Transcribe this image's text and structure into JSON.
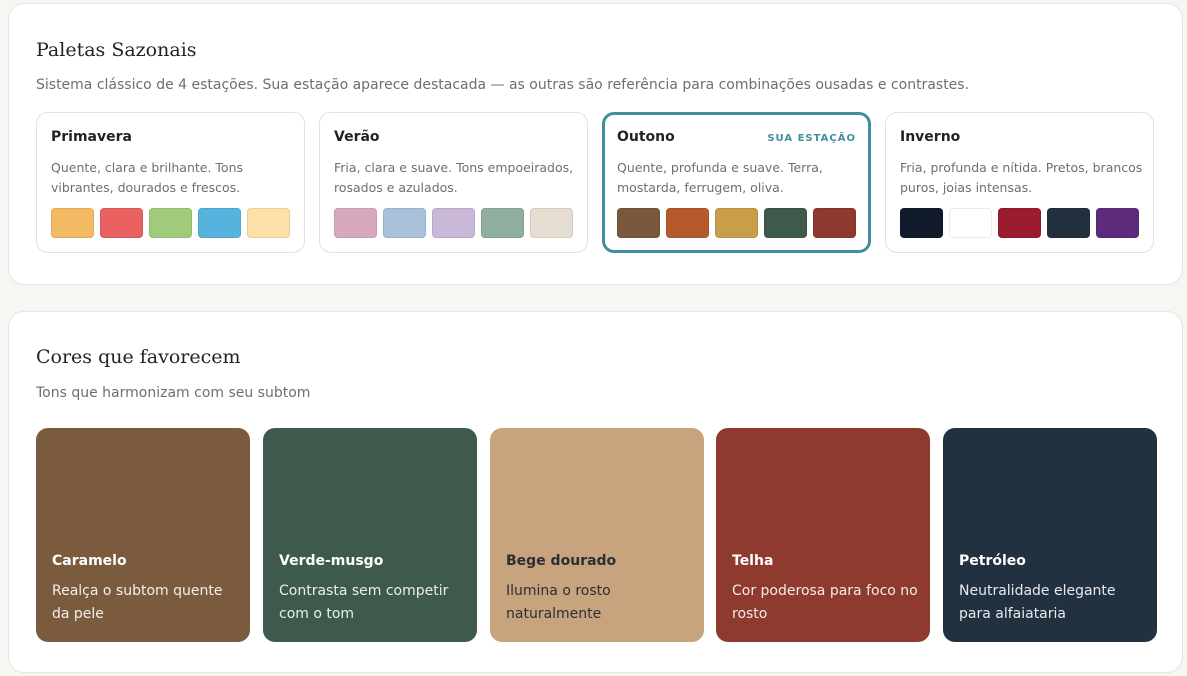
{
  "seasonal": {
    "title": "Paletas Sazonais",
    "subtitle": "Sistema clássico de 4 estações. Sua estação aparece destacada — as outras são referência para combinações ousadas e contrastes.",
    "current_badge": "SUA ESTAÇÃO",
    "accent_color": "#3f8f9c",
    "seasons": [
      {
        "name": "Primavera",
        "description": "Quente, clara e brilhante. Tons vibrantes, dourados e frescos.",
        "current": false,
        "swatches": [
          "#f4b963",
          "#e96161",
          "#9fcb7b",
          "#56b3dd",
          "#fde0a6"
        ]
      },
      {
        "name": "Verão",
        "description": "Fria, clara e suave. Tons empoeirados, rosados e azulados.",
        "current": false,
        "swatches": [
          "#d8a9bd",
          "#a9c1d9",
          "#c9b8d8",
          "#8fae9f",
          "#e5ddd1"
        ]
      },
      {
        "name": "Outono",
        "description": "Quente, profunda e suave. Terra, mostarda, ferrugem, oliva.",
        "current": true,
        "swatches": [
          "#7a583b",
          "#b75a2b",
          "#c99e4b",
          "#3e5a4c",
          "#8e392e"
        ]
      },
      {
        "name": "Inverno",
        "description": "Fria, profunda e nítida. Pretos, brancos puros, joias intensas.",
        "current": false,
        "swatches": [
          "#111a2b",
          "#ffffff",
          "#9b1c2e",
          "#222f3d",
          "#5e2b7c"
        ]
      }
    ]
  },
  "favorable": {
    "title": "Cores que favorecem",
    "subtitle": "Tons que harmonizam com seu subtom",
    "colors": [
      {
        "name": "Caramelo",
        "description": "Realça o subtom quente da pele",
        "color": "#7a5b3e",
        "text_tone": "dark"
      },
      {
        "name": "Verde-musgo",
        "description": "Contrasta sem competir com o tom",
        "color": "#3d5a4c",
        "text_tone": "dark"
      },
      {
        "name": "Bege dourado",
        "description": "Ilumina o rosto naturalmente",
        "color": "#c8a47e",
        "text_tone": "light"
      },
      {
        "name": "Telha",
        "description": "Cor poderosa para foco no rosto",
        "color": "#8e3a2e",
        "text_tone": "dark"
      },
      {
        "name": "Petróleo",
        "description": "Neutralidade elegante para alfaiataria",
        "color": "#223140",
        "text_tone": "dark"
      }
    ]
  }
}
